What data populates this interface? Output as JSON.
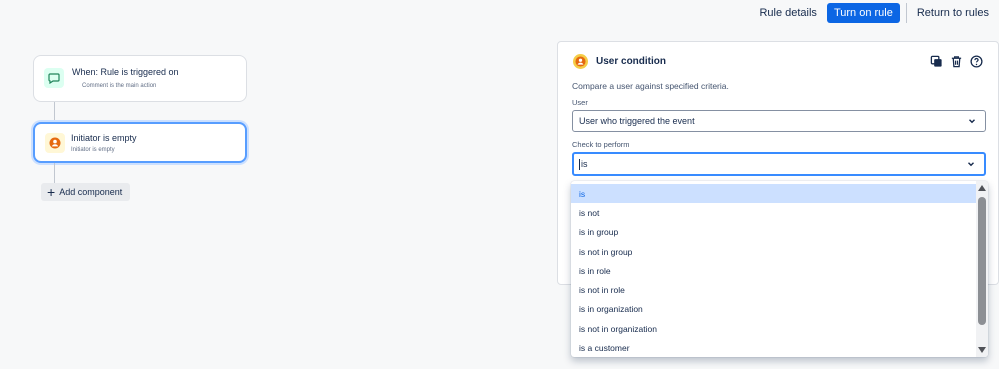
{
  "topbar": {
    "rule_details": "Rule details",
    "turn_on": "Turn on rule",
    "return": "Return to rules"
  },
  "flow": {
    "trigger": {
      "title": "When: Rule is triggered on",
      "subtitle": "Comment is the main action",
      "icon": "comment-icon"
    },
    "condition": {
      "title": "Initiator is empty",
      "subtitle": "Initiator is empty",
      "icon": "user-icon"
    },
    "add_component": "Add component"
  },
  "panel": {
    "title": "User condition",
    "description": "Compare a user against specified criteria.",
    "user_label": "User",
    "user_value": "User who triggered the event",
    "check_label": "Check to perform",
    "check_value": "is",
    "actions": [
      "copy-icon",
      "trash-icon",
      "help-icon"
    ]
  },
  "dropdown": {
    "options": [
      "is",
      "is not",
      "is in group",
      "is not in group",
      "is in role",
      "is not in role",
      "is in organization",
      "is not in organization",
      "is a customer"
    ],
    "selected_index": 0
  },
  "colors": {
    "primary": "#0c66e4",
    "selection": "#cce0ff",
    "focus": "#388bff"
  }
}
